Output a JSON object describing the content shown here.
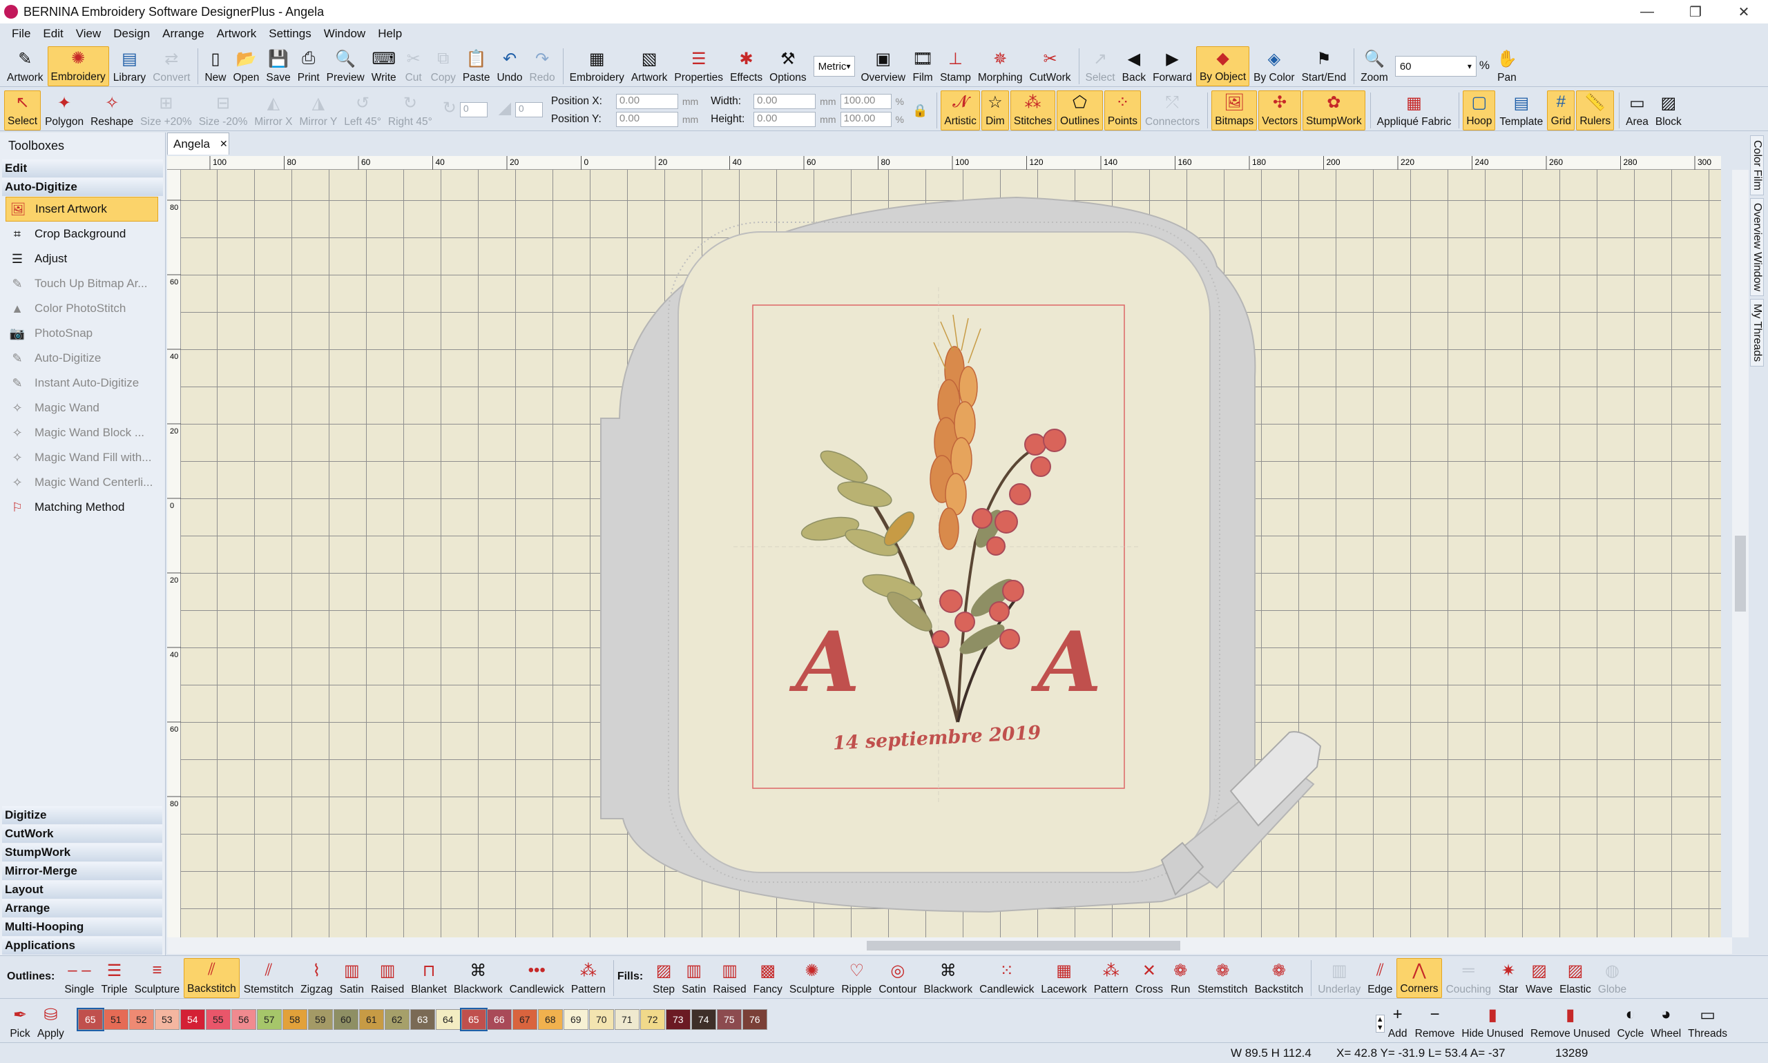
{
  "titlebar": {
    "title": "BERNINA Embroidery Software DesignerPlus - Angela"
  },
  "menu": [
    "File",
    "Edit",
    "View",
    "Design",
    "Arrange",
    "Artwork",
    "Settings",
    "Window",
    "Help"
  ],
  "toolbar1": [
    {
      "label": "Artwork",
      "icon": "artwork-mode-icon",
      "state": ""
    },
    {
      "label": "Embroidery",
      "icon": "embroidery-mode-icon",
      "state": "on"
    },
    {
      "label": "Library",
      "icon": "library-icon",
      "state": ""
    },
    {
      "label": "Convert",
      "icon": "convert-icon",
      "state": "dis"
    },
    {
      "sep": true
    },
    {
      "label": "New",
      "icon": "new-file-icon",
      "state": ""
    },
    {
      "label": "Open",
      "icon": "open-folder-icon",
      "state": ""
    },
    {
      "label": "Save",
      "icon": "save-icon",
      "state": ""
    },
    {
      "label": "Print",
      "icon": "print-icon",
      "state": ""
    },
    {
      "label": "Preview",
      "icon": "preview-icon",
      "state": ""
    },
    {
      "label": "Write",
      "icon": "write-icon",
      "state": ""
    },
    {
      "label": "Cut",
      "icon": "cut-icon",
      "state": "dis"
    },
    {
      "label": "Copy",
      "icon": "copy-icon",
      "state": "dis"
    },
    {
      "label": "Paste",
      "icon": "paste-icon",
      "state": ""
    },
    {
      "label": "Undo",
      "icon": "undo-icon",
      "state": ""
    },
    {
      "label": "Redo",
      "icon": "redo-icon",
      "state": "dis"
    },
    {
      "sep": true
    },
    {
      "label": "Embroidery",
      "icon": "embroidery-canvas-icon",
      "state": ""
    },
    {
      "label": "Artwork",
      "icon": "artwork-canvas-icon",
      "state": ""
    },
    {
      "label": "Properties",
      "icon": "properties-icon",
      "state": ""
    },
    {
      "label": "Effects",
      "icon": "effects-icon",
      "state": ""
    },
    {
      "label": "Options",
      "icon": "options-icon",
      "state": ""
    },
    {
      "combo": "Metric"
    },
    {
      "label": "Overview",
      "icon": "overview-icon",
      "state": ""
    },
    {
      "label": "Film",
      "icon": "film-icon",
      "state": ""
    },
    {
      "label": "Stamp",
      "icon": "stamp-icon",
      "state": ""
    },
    {
      "label": "Morphing",
      "icon": "morphing-icon",
      "state": ""
    },
    {
      "label": "CutWork",
      "icon": "cutwork-icon",
      "state": ""
    },
    {
      "sep": true
    },
    {
      "label": "Select",
      "icon": "select-sequence-icon",
      "state": "dis"
    },
    {
      "label": "Back",
      "icon": "back-icon",
      "state": ""
    },
    {
      "label": "Forward",
      "icon": "forward-icon",
      "state": ""
    },
    {
      "label": "By Object",
      "icon": "by-object-icon",
      "state": "on"
    },
    {
      "label": "By Color",
      "icon": "by-color-icon",
      "state": ""
    },
    {
      "label": "Start/End",
      "icon": "start-end-icon",
      "state": ""
    },
    {
      "sep": true
    },
    {
      "label": "Zoom",
      "icon": "zoom-icon",
      "state": ""
    },
    {
      "zoom": "60"
    },
    {
      "label": "Pan",
      "icon": "pan-hand-icon",
      "state": ""
    }
  ],
  "toolbar2a": [
    {
      "label": "Select",
      "icon": "select-arrow-icon",
      "state": "on"
    },
    {
      "label": "Polygon",
      "icon": "polygon-select-icon",
      "state": ""
    },
    {
      "label": "Reshape",
      "icon": "reshape-icon",
      "state": ""
    },
    {
      "label": "Size +20%",
      "icon": "size-up-icon",
      "state": "dis"
    },
    {
      "label": "Size -20%",
      "icon": "size-down-icon",
      "state": "dis"
    },
    {
      "label": "Mirror X",
      "icon": "mirror-x-icon",
      "state": "dis"
    },
    {
      "label": "Mirror Y",
      "icon": "mirror-y-icon",
      "state": "dis"
    },
    {
      "label": "Left 45°",
      "icon": "rotate-left-icon",
      "state": "dis"
    },
    {
      "label": "Right 45°",
      "icon": "rotate-right-icon",
      "state": "dis"
    }
  ],
  "rotate_value": "0",
  "skew_value": "0",
  "position": {
    "x_label": "Position X:",
    "y_label": "Position Y:",
    "x": "0.00",
    "y": "0.00",
    "unit": "mm"
  },
  "size": {
    "w_label": "Width:",
    "h_label": "Height:",
    "w": "0.00",
    "h": "0.00",
    "unit": "mm",
    "wp": "100.00",
    "hp": "100.00",
    "pct": "%"
  },
  "toolbar2b": [
    {
      "label": "Artistic",
      "icon": "artistic-icon",
      "state": "on"
    },
    {
      "label": "Dim",
      "icon": "dim-icon",
      "state": "on"
    },
    {
      "label": "Stitches",
      "icon": "stitches-icon",
      "state": "on"
    },
    {
      "label": "Outlines",
      "icon": "outlines-icon",
      "state": "on"
    },
    {
      "label": "Points",
      "icon": "points-icon",
      "state": "on"
    },
    {
      "label": "Connectors",
      "icon": "connectors-icon",
      "state": "dis"
    },
    {
      "label": "Bitmaps",
      "icon": "bitmaps-icon",
      "state": "on"
    },
    {
      "label": "Vectors",
      "icon": "vectors-icon",
      "state": "on"
    },
    {
      "label": "StumpWork",
      "icon": "stumpwork-icon",
      "state": "on"
    },
    {
      "label": "Appliqué Fabric",
      "icon": "applique-fabric-icon",
      "state": ""
    },
    {
      "label": "Hoop",
      "icon": "hoop-icon",
      "state": "on"
    },
    {
      "label": "Template",
      "icon": "template-icon",
      "state": ""
    },
    {
      "label": "Grid",
      "icon": "grid-icon",
      "state": "on"
    },
    {
      "label": "Rulers",
      "icon": "rulers-icon",
      "state": "on"
    },
    {
      "label": "Area",
      "icon": "area-icon",
      "state": ""
    },
    {
      "label": "Block",
      "icon": "block-icon",
      "state": ""
    }
  ],
  "toolboxes": {
    "title": "Toolboxes",
    "top_cats": [
      "Edit",
      "Auto-Digitize"
    ],
    "tools": [
      {
        "label": "Insert Artwork",
        "icon": "insert-artwork-icon",
        "state": "sel"
      },
      {
        "label": "Crop Background",
        "icon": "crop-icon",
        "state": "act"
      },
      {
        "label": "Adjust",
        "icon": "adjust-icon",
        "state": "act"
      },
      {
        "label": "Touch Up Bitmap Ar...",
        "icon": "touch-up-icon",
        "state": ""
      },
      {
        "label": "Color PhotoStitch",
        "icon": "photostitch-icon",
        "state": ""
      },
      {
        "label": "PhotoSnap",
        "icon": "camera-icon",
        "state": ""
      },
      {
        "label": "Auto-Digitize",
        "icon": "auto-digitize-icon",
        "state": ""
      },
      {
        "label": "Instant Auto-Digitize",
        "icon": "instant-digitize-icon",
        "state": ""
      },
      {
        "label": "Magic Wand",
        "icon": "magic-wand-icon",
        "state": ""
      },
      {
        "label": "Magic Wand Block ...",
        "icon": "magic-wand-block-icon",
        "state": ""
      },
      {
        "label": "Magic Wand Fill with...",
        "icon": "magic-wand-fill-icon",
        "state": ""
      },
      {
        "label": "Magic Wand Centerli...",
        "icon": "magic-wand-centerline-icon",
        "state": ""
      },
      {
        "label": "Matching Method",
        "icon": "matching-method-icon",
        "state": "act"
      }
    ],
    "bottom_cats": [
      "Digitize",
      "CutWork",
      "StumpWork",
      "Mirror-Merge",
      "Layout",
      "Arrange",
      "Multi-Hooping",
      "Applications"
    ]
  },
  "doc_tab": "Angela",
  "ruler_h": [
    "100",
    "80",
    "60",
    "40",
    "20",
    "0",
    "20",
    "40",
    "60",
    "80",
    "100",
    "120",
    "140",
    "160",
    "180",
    "200",
    "220",
    "240",
    "260",
    "280",
    "300"
  ],
  "ruler_v": [
    "80",
    "60",
    "40",
    "20",
    "0",
    "20",
    "40",
    "60",
    "80"
  ],
  "design": {
    "monogram_left": "A",
    "monogram_right": "A",
    "date_text": "14 septiembre 2019"
  },
  "dock_tabs": [
    "Color Film",
    "Overview Window",
    "My Threads"
  ],
  "outlines": {
    "label": "Outlines:",
    "items": [
      {
        "label": "Single",
        "icon": "single-outline-icon",
        "state": ""
      },
      {
        "label": "Triple",
        "icon": "triple-outline-icon",
        "state": ""
      },
      {
        "label": "Sculpture",
        "icon": "sculpture-outline-icon",
        "state": ""
      },
      {
        "label": "Backstitch",
        "icon": "backstitch-icon",
        "state": "on"
      },
      {
        "label": "Stemstitch",
        "icon": "stemstitch-icon",
        "state": ""
      },
      {
        "label": "Zigzag",
        "icon": "zigzag-icon",
        "state": ""
      },
      {
        "label": "Satin",
        "icon": "satin-outline-icon",
        "state": ""
      },
      {
        "label": "Raised",
        "icon": "raised-outline-icon",
        "state": ""
      },
      {
        "label": "Blanket",
        "icon": "blanket-icon",
        "state": ""
      },
      {
        "label": "Blackwork",
        "icon": "blackwork-outline-icon",
        "state": ""
      },
      {
        "label": "Candlewick",
        "icon": "candlewick-outline-icon",
        "state": ""
      },
      {
        "label": "Pattern",
        "icon": "pattern-outline-icon",
        "state": ""
      }
    ]
  },
  "fills": {
    "label": "Fills:",
    "items": [
      {
        "label": "Step",
        "icon": "step-fill-icon",
        "state": ""
      },
      {
        "label": "Satin",
        "icon": "satin-fill-icon",
        "state": ""
      },
      {
        "label": "Raised",
        "icon": "raised-fill-icon",
        "state": ""
      },
      {
        "label": "Fancy",
        "icon": "fancy-fill-icon",
        "state": ""
      },
      {
        "label": "Sculpture",
        "icon": "sculpture-fill-icon",
        "state": ""
      },
      {
        "label": "Ripple",
        "icon": "ripple-icon",
        "state": ""
      },
      {
        "label": "Contour",
        "icon": "contour-icon",
        "state": ""
      },
      {
        "label": "Blackwork",
        "icon": "blackwork-fill-icon",
        "state": ""
      },
      {
        "label": "Candlewick",
        "icon": "candlewick-fill-icon",
        "state": ""
      },
      {
        "label": "Lacework",
        "icon": "lacework-icon",
        "state": ""
      },
      {
        "label": "Pattern",
        "icon": "pattern-fill-icon",
        "state": ""
      },
      {
        "label": "Cross",
        "icon": "cross-stitch-icon",
        "state": ""
      },
      {
        "label": "Run",
        "icon": "run-icon",
        "state": ""
      },
      {
        "label": "Stemstitch",
        "icon": "stemstitch-fill-icon",
        "state": ""
      },
      {
        "label": "Backstitch",
        "icon": "backstitch-fill-icon",
        "state": ""
      }
    ]
  },
  "effects": [
    {
      "label": "Underlay",
      "icon": "underlay-icon",
      "state": "dis"
    },
    {
      "label": "Edge",
      "icon": "edge-icon",
      "state": ""
    },
    {
      "label": "Corners",
      "icon": "corners-icon",
      "state": "on"
    },
    {
      "label": "Couching",
      "icon": "couching-icon",
      "state": "dis"
    },
    {
      "label": "Star",
      "icon": "star-icon",
      "state": ""
    },
    {
      "label": "Wave",
      "icon": "wave-icon",
      "state": ""
    },
    {
      "label": "Elastic",
      "icon": "elastic-icon",
      "state": ""
    },
    {
      "label": "Globe",
      "icon": "globe-icon",
      "state": "dis"
    }
  ],
  "palette": {
    "pick": "Pick",
    "apply": "Apply",
    "colors": [
      {
        "n": "65",
        "c": "#c0504d",
        "fg": "#fff",
        "sel": true
      },
      {
        "n": "51",
        "c": "#e56b55",
        "fg": "#222"
      },
      {
        "n": "52",
        "c": "#ee8a73",
        "fg": "#222"
      },
      {
        "n": "53",
        "c": "#f4b6a0",
        "fg": "#222"
      },
      {
        "n": "54",
        "c": "#d42035",
        "fg": "#fff"
      },
      {
        "n": "55",
        "c": "#e9566a",
        "fg": "#222"
      },
      {
        "n": "56",
        "c": "#f08a8f",
        "fg": "#222"
      },
      {
        "n": "57",
        "c": "#a6c66a",
        "fg": "#222"
      },
      {
        "n": "58",
        "c": "#e2a13a",
        "fg": "#222"
      },
      {
        "n": "59",
        "c": "#a49a66",
        "fg": "#222"
      },
      {
        "n": "60",
        "c": "#8e8f64",
        "fg": "#222"
      },
      {
        "n": "61",
        "c": "#c79b45",
        "fg": "#222"
      },
      {
        "n": "62",
        "c": "#a6a06a",
        "fg": "#222"
      },
      {
        "n": "63",
        "c": "#7a6a55",
        "fg": "#fff"
      },
      {
        "n": "64",
        "c": "#f3ecc2",
        "fg": "#222"
      },
      {
        "n": "65",
        "c": "#c0504d",
        "fg": "#fff",
        "sel": true
      },
      {
        "n": "66",
        "c": "#a94a58",
        "fg": "#fff"
      },
      {
        "n": "67",
        "c": "#d9643e",
        "fg": "#222"
      },
      {
        "n": "68",
        "c": "#f1b14e",
        "fg": "#222"
      },
      {
        "n": "69",
        "c": "#f7f1d4",
        "fg": "#222"
      },
      {
        "n": "70",
        "c": "#f3e4b0",
        "fg": "#222"
      },
      {
        "n": "71",
        "c": "#efe9cf",
        "fg": "#222"
      },
      {
        "n": "72",
        "c": "#f1d98a",
        "fg": "#222"
      },
      {
        "n": "73",
        "c": "#6b1a23",
        "fg": "#fff"
      },
      {
        "n": "74",
        "c": "#3e2f29",
        "fg": "#fff"
      },
      {
        "n": "75",
        "c": "#8c4b4f",
        "fg": "#fff"
      },
      {
        "n": "76",
        "c": "#7a4037",
        "fg": "#fff"
      }
    ],
    "actions": [
      {
        "label": "Add",
        "icon": "add-plus-icon"
      },
      {
        "label": "Remove",
        "icon": "remove-minus-icon"
      },
      {
        "label": "Hide Unused",
        "icon": "hide-unused-icon"
      },
      {
        "label": "Remove Unused",
        "icon": "remove-unused-icon"
      },
      {
        "label": "Cycle",
        "icon": "cycle-icon"
      },
      {
        "label": "Wheel",
        "icon": "color-wheel-icon"
      },
      {
        "label": "Threads",
        "icon": "threads-icon"
      }
    ]
  },
  "status": {
    "wh": "W  89.5 H 112.4",
    "coords": "X=  42.8 Y= -31.9 L=  53.4 A= -37",
    "stitches": "13289"
  }
}
